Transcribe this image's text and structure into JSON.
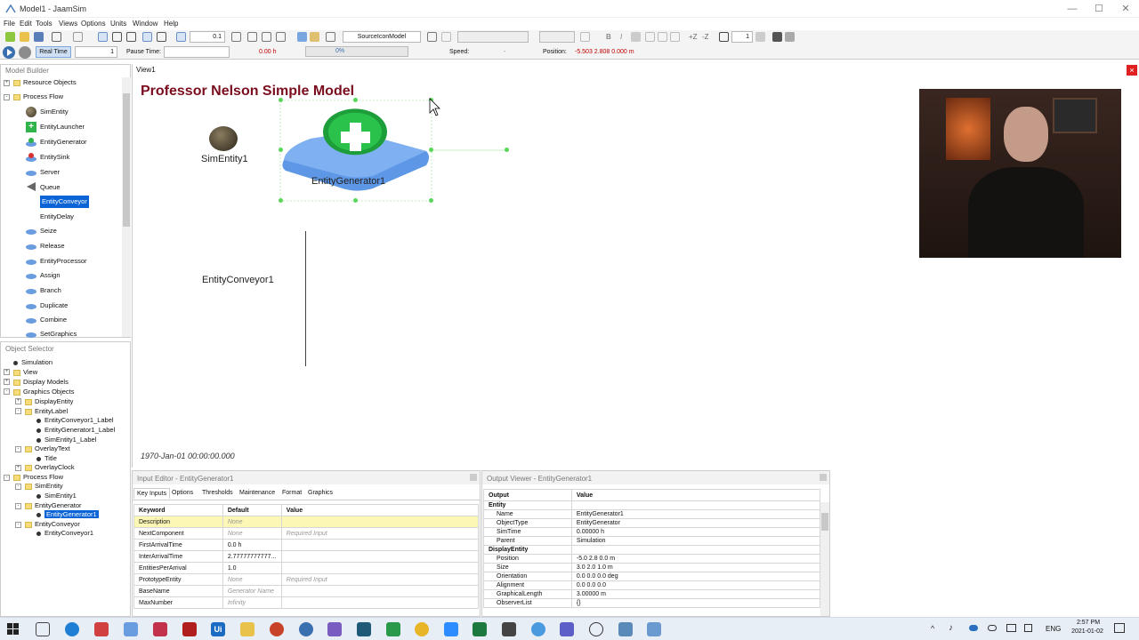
{
  "window": {
    "title": "Model1 - JaamSim",
    "controls": [
      "—",
      "☐",
      "✕"
    ]
  },
  "menu": [
    "File",
    "Edit",
    "Tools",
    "Views",
    "Options",
    "Units",
    "Window",
    "Help"
  ],
  "toolbar": {
    "zoom_value": "0.1",
    "display_model": "SourceIconModel",
    "font_size": "",
    "line_width": "1"
  },
  "runbar": {
    "real_time_label": "Real Time",
    "real_time_factor": "1",
    "pause_time_label": "Pause Time:",
    "sim_time": "0.00  h",
    "progress": "0%",
    "progress_fraction": 0,
    "speed_label": "Speed:",
    "speed_value": "-",
    "position_label": "Position:",
    "position_value": "-5.503  2.808  0.000  m"
  },
  "model_builder": {
    "title": "Model Builder",
    "items": [
      {
        "label": "Resource Objects",
        "type": "folder"
      },
      {
        "label": "Process Flow",
        "type": "folder"
      },
      {
        "label": "SimEntity",
        "icon": "sphere-icon"
      },
      {
        "label": "EntityLauncher",
        "icon": "plus-icon"
      },
      {
        "label": "EntityGenerator",
        "icon": "generator-icon"
      },
      {
        "label": "EntitySink",
        "icon": "sink-icon"
      },
      {
        "label": "Server",
        "icon": "server-icon"
      },
      {
        "label": "Queue",
        "icon": "queue-icon"
      },
      {
        "label": "EntityConveyor",
        "icon": "none",
        "selected": true
      },
      {
        "label": "EntityDelay",
        "icon": "none"
      },
      {
        "label": "Seize",
        "icon": "seize-icon"
      },
      {
        "label": "Release",
        "icon": "release-icon"
      },
      {
        "label": "EntityProcessor",
        "icon": "processor-icon"
      },
      {
        "label": "Assign",
        "icon": "assign-icon"
      },
      {
        "label": "Branch",
        "icon": "branch-icon"
      },
      {
        "label": "Duplicate",
        "icon": "duplicate-icon"
      },
      {
        "label": "Combine",
        "icon": "combine-icon"
      },
      {
        "label": "SetGraphics",
        "icon": "setgraphics-icon"
      }
    ]
  },
  "object_selector": {
    "title": "Object Selector",
    "items": [
      {
        "label": "Simulation",
        "level": 1,
        "kind": "dot"
      },
      {
        "label": "View",
        "level": 0,
        "kind": "folder",
        "exp": "+"
      },
      {
        "label": "Display Models",
        "level": 0,
        "kind": "folder",
        "exp": "+"
      },
      {
        "label": "Graphics Objects",
        "level": 0,
        "kind": "folder",
        "exp": "-"
      },
      {
        "label": "DisplayEntity",
        "level": 1,
        "kind": "folder",
        "exp": "+"
      },
      {
        "label": "EntityLabel",
        "level": 1,
        "kind": "folder",
        "exp": "-"
      },
      {
        "label": "EntityConveyor1_Label",
        "level": 2,
        "kind": "dot"
      },
      {
        "label": "EntityGenerator1_Label",
        "level": 2,
        "kind": "dot"
      },
      {
        "label": "SimEntity1_Label",
        "level": 2,
        "kind": "dot"
      },
      {
        "label": "OverlayText",
        "level": 1,
        "kind": "folder",
        "exp": "-"
      },
      {
        "label": "Title",
        "level": 2,
        "kind": "dot"
      },
      {
        "label": "OverlayClock",
        "level": 1,
        "kind": "folder",
        "exp": "+"
      },
      {
        "label": "Process Flow",
        "level": 0,
        "kind": "folder",
        "exp": "-"
      },
      {
        "label": "SimEntity",
        "level": 1,
        "kind": "folder",
        "exp": "-"
      },
      {
        "label": "SimEntity1",
        "level": 2,
        "kind": "dot"
      },
      {
        "label": "EntityGenerator",
        "level": 1,
        "kind": "folder",
        "exp": "-"
      },
      {
        "label": "EntityGenerator1",
        "level": 2,
        "kind": "dot",
        "selected": true
      },
      {
        "label": "EntityConveyor",
        "level": 1,
        "kind": "folder",
        "exp": "-"
      },
      {
        "label": "EntityConveyor1",
        "level": 2,
        "kind": "dot"
      }
    ]
  },
  "view": {
    "tab": "View1",
    "close": "×",
    "model_title": "Professor Nelson Simple Model",
    "sim_entity_label": "SimEntity1",
    "generator_label": "EntityGenerator1",
    "conveyor_label": "EntityConveyor1",
    "clock": "1970-Jan-01 00:00:00.000"
  },
  "input_editor": {
    "title": "Input Editor - EntityGenerator1",
    "tabs": [
      "Key Inputs",
      "Options",
      "Thresholds",
      "Maintenance",
      "Format",
      "Graphics"
    ],
    "headers": [
      "Keyword",
      "Default",
      "Value"
    ],
    "rows": [
      [
        "Description",
        "None",
        ""
      ],
      [
        "NextComponent",
        "None",
        "Required Input"
      ],
      [
        "FirstArrivalTime",
        "0.0  h",
        ""
      ],
      [
        "InterArrivalTime",
        "2.77777777777...",
        ""
      ],
      [
        "EntitiesPerArrival",
        "1.0",
        ""
      ],
      [
        "PrototypeEntity",
        "None",
        "Required Input"
      ],
      [
        "BaseName",
        "Generator Name",
        ""
      ],
      [
        "MaxNumber",
        "Infinity",
        ""
      ]
    ]
  },
  "output_viewer": {
    "title": "Output Viewer - EntityGenerator1",
    "headers": [
      "Output",
      "Value"
    ],
    "rows": [
      [
        "Entity",
        "",
        "section"
      ],
      [
        "Name",
        "EntityGenerator1",
        ""
      ],
      [
        "ObjectType",
        "EntityGenerator",
        ""
      ],
      [
        "SimTime",
        "0.00000  h",
        ""
      ],
      [
        "Parent",
        "Simulation",
        ""
      ],
      [
        "DisplayEntity",
        "",
        "section"
      ],
      [
        "Position",
        "-5.0  2.8  0.0  m",
        ""
      ],
      [
        "Size",
        "3.0  2.0  1.0  m",
        ""
      ],
      [
        "Orientation",
        "0.0  0.0  0.0  deg",
        ""
      ],
      [
        "Alignment",
        "0.0  0.0  0.0",
        ""
      ],
      [
        "GraphicalLength",
        "3.00000  m",
        ""
      ],
      [
        "ObserverList",
        "{}",
        ""
      ]
    ]
  },
  "taskbar": {
    "lang": "ENG",
    "time": "2:57 PM",
    "date": "2021-01-02"
  }
}
